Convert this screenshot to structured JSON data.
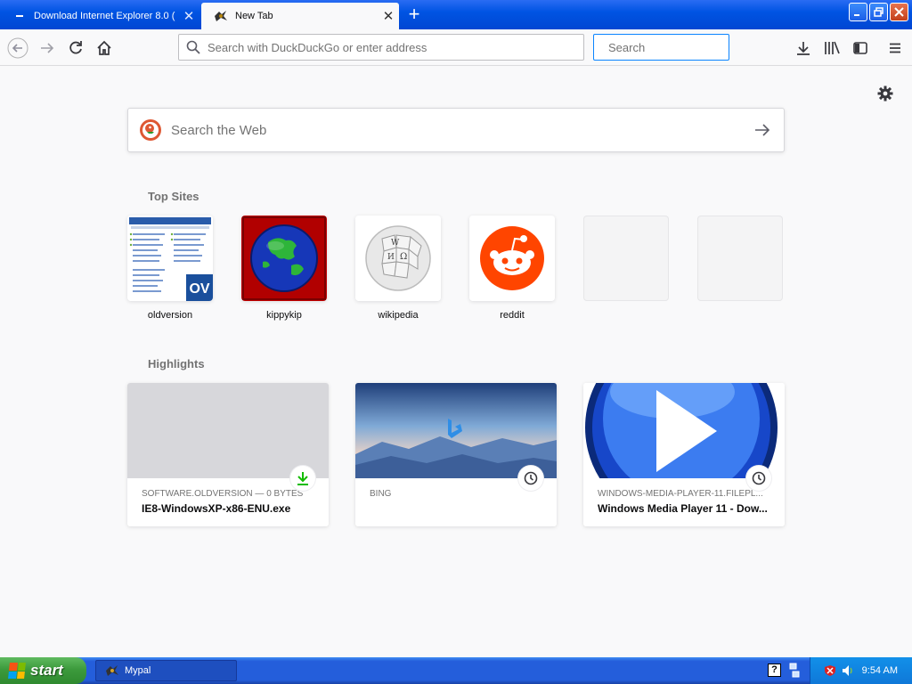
{
  "tabs": [
    {
      "title": "Download Internet Explorer 8.0 (",
      "active": false
    },
    {
      "title": "New Tab",
      "active": true
    }
  ],
  "navbar": {
    "url_placeholder": "Search with DuckDuckGo or enter address",
    "search_placeholder": "Search"
  },
  "newtab": {
    "web_search_placeholder": "Search the Web",
    "top_sites_title": "Top Sites",
    "top_sites": [
      {
        "label": "oldversion",
        "icon": "oldversion-thumbnail"
      },
      {
        "label": "kippykip",
        "icon": "globe-icon"
      },
      {
        "label": "wikipedia",
        "icon": "wikipedia-globe-icon"
      },
      {
        "label": "reddit",
        "icon": "reddit-alien-icon"
      },
      {
        "label": "",
        "icon": "empty"
      },
      {
        "label": "",
        "icon": "empty"
      }
    ],
    "highlights_title": "Highlights",
    "highlights": [
      {
        "source": "SOFTWARE.OLDVERSION — 0 BYTES",
        "title": "IE8-WindowsXP-x86-ENU.exe",
        "badge": "download-icon"
      },
      {
        "source": "BING",
        "title": "",
        "badge": "clock-icon"
      },
      {
        "source": "WINDOWS-MEDIA-PLAYER-11.FILEPL...",
        "title": "Windows Media Player 11 - Dow...",
        "badge": "clock-icon"
      }
    ]
  },
  "taskbar": {
    "start_label": "start",
    "task_label": "Mypal",
    "clock": "9:54 AM"
  },
  "colors": {
    "xp_blue": "#0054e3",
    "accent_blue": "#0a84ff",
    "reddit_orange": "#ff4500",
    "download_green": "#12bc00"
  }
}
